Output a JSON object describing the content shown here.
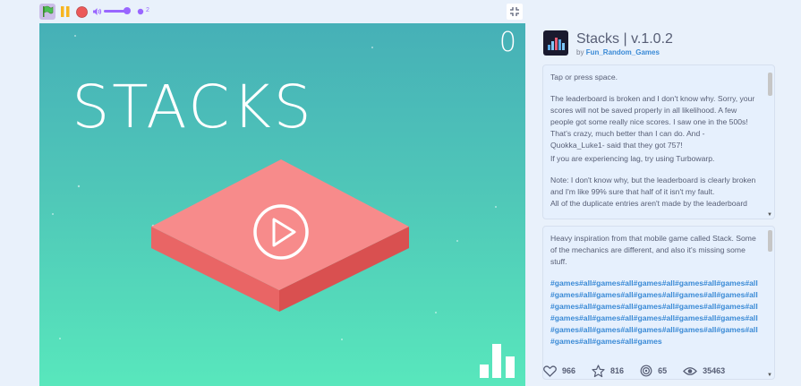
{
  "toolbar": {
    "clone_count": "2"
  },
  "stage": {
    "score": "0",
    "title": "STACKS"
  },
  "project": {
    "title": "Stacks | v.1.0.2",
    "by_prefix": "by",
    "author": "Fun_Random_Games"
  },
  "instructions": {
    "paragraphs": [
      "Tap or press space.",
      "The leaderboard is broken and I don't know why. Sorry, your scores will not be saved properly in all likelihood. A few people got some really nice scores. I saw one in the 500s! That's crazy, much better than I can do. And -Quokka_Luke1- said that they got 757!",
      "If you are experiencing lag, try using Turbowarp.",
      "Note: I don't know why, but the leaderboard is clearly broken and I'm like 99% sure that half of it isn't my fault.",
      "All of the duplicate entries aren't made by the leaderboard"
    ]
  },
  "notes": {
    "text": "Heavy inspiration from that mobile game called Stack. Some of the mechanics are different, and also it's missing some stuff.",
    "tags": "#games#all#games#all#games#all#games#all#games#all#games#all#games#all#games#all#games#all#games#all#games#all#games#all#games#all#games#all#games#all#games#all#games#all#games#all#games#all#games#all#games#all#games#all#games#all#games#all#games#all#games#all#games#all#games"
  },
  "stats": {
    "loves": "966",
    "favorites": "816",
    "remixes": "65",
    "views": "35463"
  },
  "colors": {
    "stage_top": "#46b0b7",
    "stage_bottom": "#58e7bc",
    "block_top": "#f78b8b",
    "block_side_left": "#e96565",
    "block_side_right": "#d95050",
    "link": "#3a8ad6",
    "accent_purple": "#9966ff"
  },
  "icons": {
    "green_flag": "green-flag-icon",
    "pause": "pause-icon",
    "stop": "stop-icon",
    "volume": "volume-icon",
    "fullscreen": "fullscreen-icon",
    "play": "play-icon",
    "leaderboard": "leaderboard-icon",
    "love": "heart-icon",
    "favorite": "star-icon",
    "remix": "remix-icon",
    "view": "eye-icon"
  }
}
